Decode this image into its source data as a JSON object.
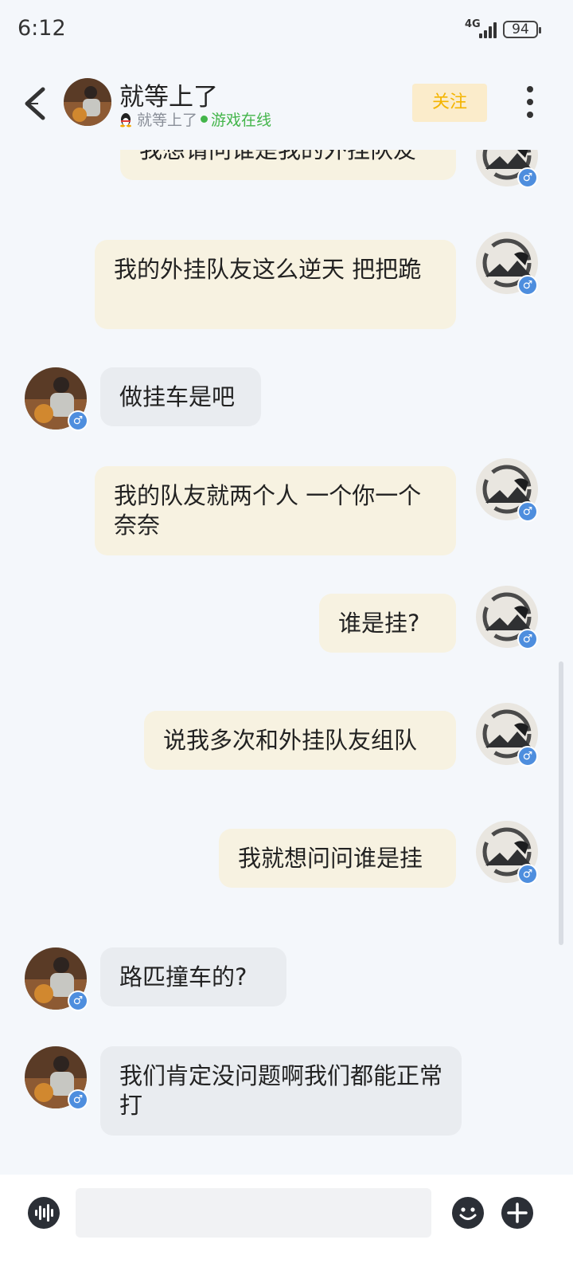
{
  "status_bar": {
    "time": "6:12",
    "network": "4G",
    "battery": "94"
  },
  "header": {
    "title": "就等上了",
    "subtitle_name": "就等上了",
    "subtitle_status": "游戏在线",
    "follow_label": "关注"
  },
  "messages": [
    {
      "sender": "me",
      "text": "我想请问谁是我的外挂队友"
    },
    {
      "sender": "me",
      "text": "我的外挂队友这么逆天  把把跪"
    },
    {
      "sender": "them",
      "text": "做挂车是吧"
    },
    {
      "sender": "me",
      "text": "我的队友就两个人  一个你一个奈奈"
    },
    {
      "sender": "me",
      "text": "谁是挂?"
    },
    {
      "sender": "me",
      "text": "说我多次和外挂队友组队"
    },
    {
      "sender": "me",
      "text": "我就想问问谁是挂"
    },
    {
      "sender": "them",
      "text": "路匹撞车的?"
    },
    {
      "sender": "them",
      "text": "我们肯定没问题啊我们都能正常打"
    }
  ],
  "input": {
    "placeholder": ""
  },
  "icons": {
    "back": "back-arrow-icon",
    "more": "more-vertical-icon",
    "voice": "voice-icon",
    "emoji": "emoji-icon",
    "plus": "plus-icon",
    "gender": "male-icon"
  },
  "colors": {
    "my_bubble": "#f7f2e1",
    "their_bubble": "#e9ecf0",
    "follow_bg": "#fbeccb",
    "follow_text": "#f4b400",
    "online": "#43b54a",
    "gender_badge": "#4e8ede"
  }
}
